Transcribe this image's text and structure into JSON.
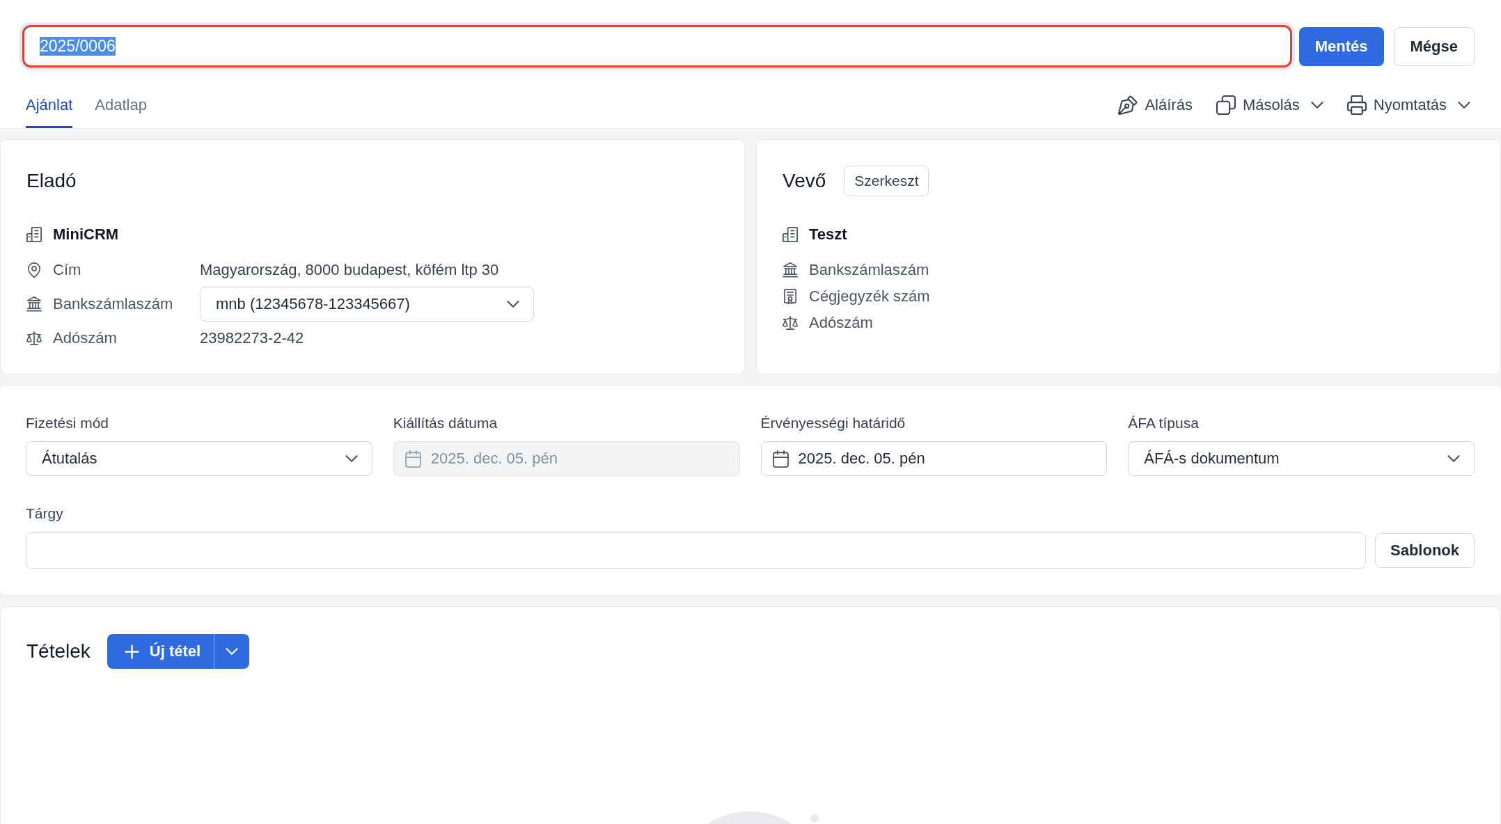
{
  "header": {
    "title_input": {
      "value": "2025/0006",
      "invalid": true,
      "focused": true,
      "text_selected": true
    },
    "save_button": "Mentés",
    "cancel_button": "Mégse"
  },
  "tabs": [
    {
      "label": "Ajánlat",
      "selected": true
    },
    {
      "label": "Adatlap",
      "selected": false
    }
  ],
  "actions": [
    {
      "kind": "sign",
      "label": "Aláírás",
      "dropdown": false
    },
    {
      "kind": "copy",
      "label": "Másolás",
      "dropdown": true
    },
    {
      "kind": "print",
      "label": "Nyomtatás",
      "dropdown": true
    }
  ],
  "seller": {
    "title": "Eladó",
    "name": "MiniCRM",
    "rows": [
      {
        "kind": "address",
        "label": "Cím",
        "value": "Magyarország, 8000 budapest, köfém ltp 30"
      },
      {
        "kind": "bank",
        "label": "Bankszámlaszám",
        "select": "mnb (12345678-123345667)"
      },
      {
        "kind": "tax",
        "label": "Adószám",
        "value": "23982273-2-42"
      }
    ]
  },
  "buyer": {
    "title": "Vevő",
    "edit_button": "Szerkeszt",
    "name": "Teszt",
    "rows": [
      {
        "kind": "bank",
        "label": "Bankszámlaszám"
      },
      {
        "kind": "registry",
        "label": "Cégjegyzék szám"
      },
      {
        "kind": "tax",
        "label": "Adószám"
      }
    ]
  },
  "document": {
    "fields": [
      {
        "kind": "select",
        "label": "Fizetési mód",
        "value": "Átutalás",
        "disabled": false
      },
      {
        "kind": "date",
        "label": "Kiállítás dátuma",
        "value": "2025. dec. 05. pén",
        "disabled": true
      },
      {
        "kind": "date",
        "label": "Érvényességi határidő",
        "value": "2025. dec. 05. pén",
        "disabled": false
      },
      {
        "kind": "select",
        "label": "ÁFA típusa",
        "value": "ÁFÁ-s dokumentum",
        "disabled": false
      }
    ],
    "subject": {
      "label": "Tárgy",
      "templates_button": "Sablonok"
    }
  },
  "items": {
    "title": "Tételek",
    "add_button": "Új tétel"
  }
}
